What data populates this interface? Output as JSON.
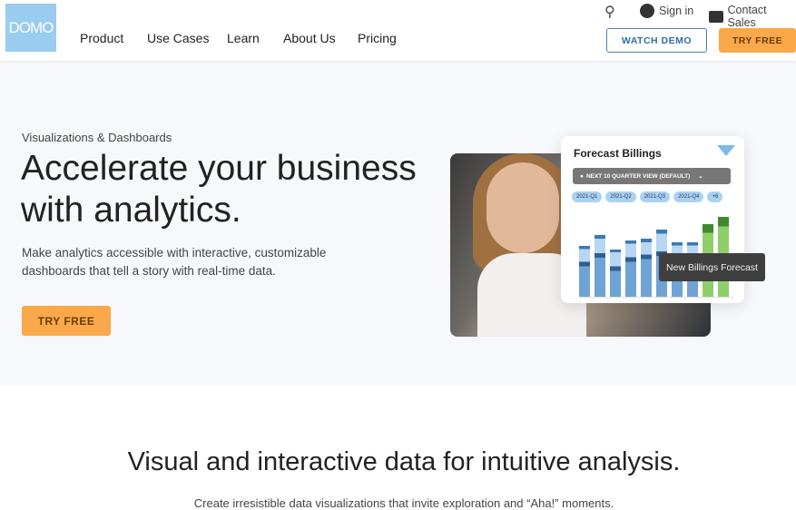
{
  "header": {
    "logo": "DOMO",
    "nav": [
      "Product",
      "Use Cases",
      "Learn",
      "About Us",
      "Pricing"
    ],
    "sign_in": "Sign in",
    "contact": "Contact Sales",
    "watch_demo": "WATCH DEMO",
    "try_free": "TRY FREE"
  },
  "hero": {
    "eyebrow": "Visualizations & Dashboards",
    "title": "Accelerate your business with analytics.",
    "subtitle": "Make analytics accessible with interactive, customizable dashboards that tell a story with real-time data.",
    "cta": "TRY FREE"
  },
  "card": {
    "title": "Forecast Billings",
    "view": "NEXT 10 QUARTER VIEW (DEFAULT)",
    "chips": [
      "2021-Q1",
      "2021-Q2",
      "2021-Q3",
      "2021-Q4",
      "+6"
    ],
    "tooltip": "New Billings Forecast"
  },
  "section": {
    "title": "Visual and interactive data for intuitive analysis.",
    "subtitle": "Create irresistible data visualizations that invite exploration and “Aha!” moments."
  },
  "colors": {
    "accent": "#f9a84a",
    "primary_blue": "#2f6ea8",
    "logo_bg": "#99ccee"
  }
}
